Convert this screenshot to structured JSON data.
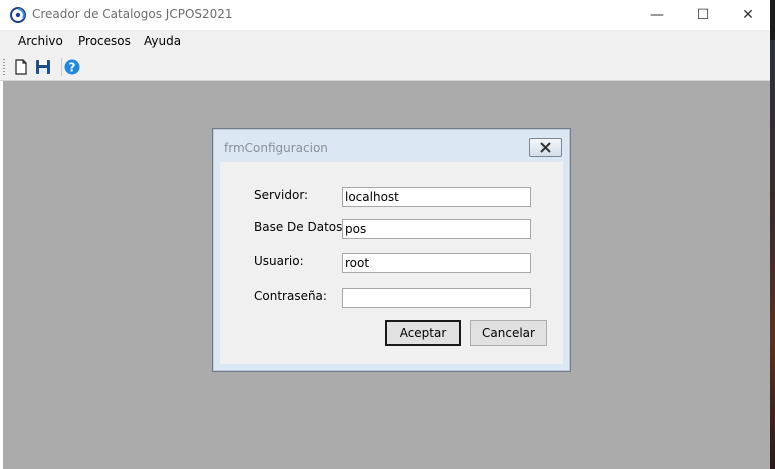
{
  "window": {
    "title": "Creador de Catalogos JCPOS2021",
    "controls": {
      "minimize": "—",
      "maximize": "☐",
      "close": "✕"
    }
  },
  "menubar": {
    "items": [
      {
        "label": "Archivo"
      },
      {
        "label": "Procesos"
      },
      {
        "label": "Ayuda"
      }
    ]
  },
  "toolbar": {
    "buttons": [
      {
        "icon": "new-document-icon"
      },
      {
        "icon": "save-icon"
      },
      {
        "icon": "help-icon"
      }
    ]
  },
  "dialog": {
    "title": "frmConfiguracion",
    "close_icon": "close-icon",
    "fields": {
      "servidor": {
        "label": "Servidor:",
        "value": "localhost"
      },
      "base_datos": {
        "label": "Base De Datos:",
        "value": "pos"
      },
      "usuario": {
        "label": "Usuario:",
        "value": "root"
      },
      "contrasena": {
        "label": "Contraseña:",
        "value": ""
      }
    },
    "accept_label": "Aceptar",
    "cancel_label": "Cancelar"
  },
  "colors": {
    "mdi_background": "#ababab",
    "dialog_frame": "#dbe7f3",
    "help_blue": "#1e88e5",
    "save_blue": "#1d4f91"
  }
}
